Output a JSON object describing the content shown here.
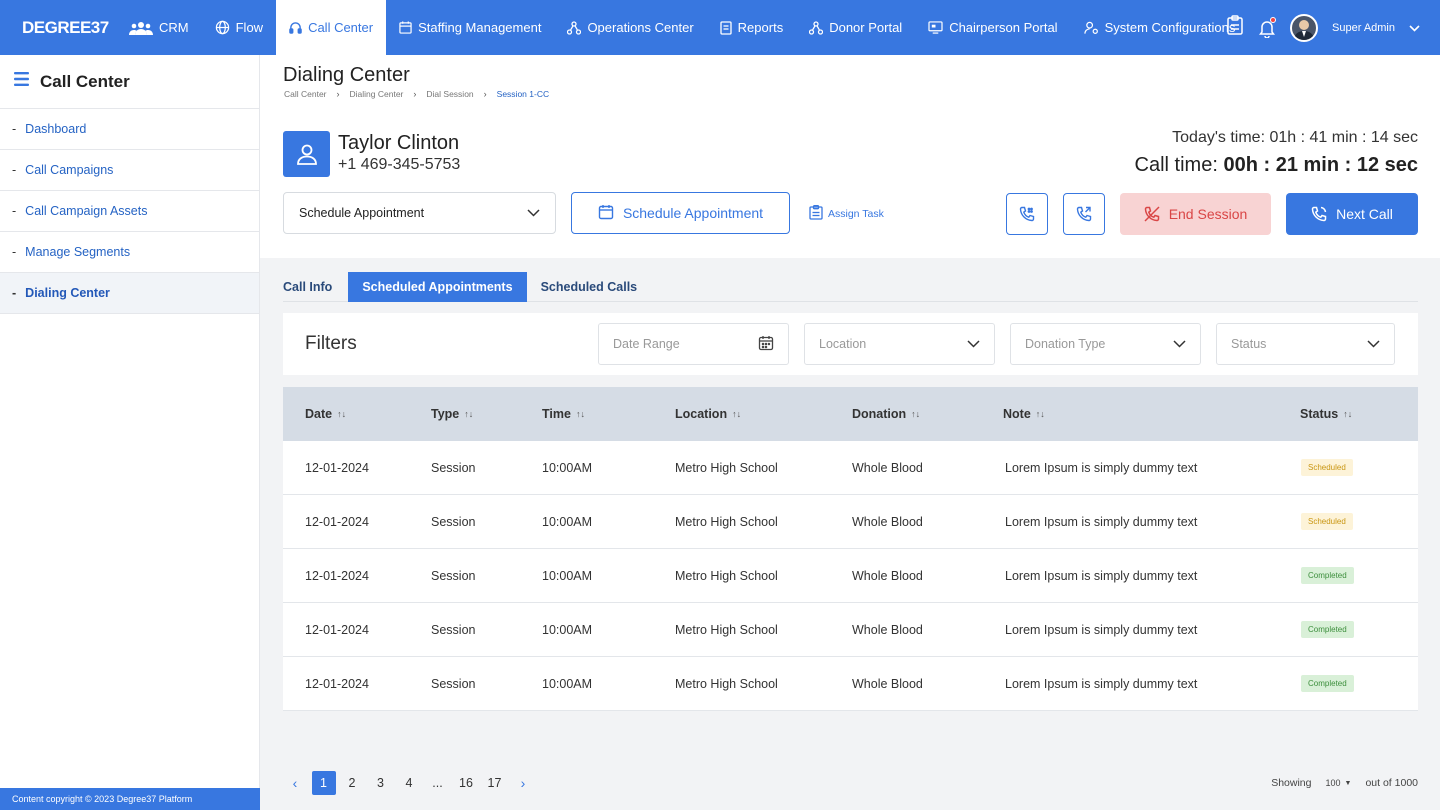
{
  "brand": "DEGREE37",
  "nav": {
    "items": [
      {
        "label": "CRM",
        "icon": "users-icon"
      },
      {
        "label": "Flow",
        "icon": "globe-icon"
      },
      {
        "label": "Call Center",
        "icon": "headset-icon",
        "active": true
      },
      {
        "label": "Staffing Management",
        "icon": "calendar-icon"
      },
      {
        "label": "Operations Center",
        "icon": "network-icon"
      },
      {
        "label": "Reports",
        "icon": "report-icon"
      },
      {
        "label": "Donor Portal",
        "icon": "network-icon"
      },
      {
        "label": "Chairperson Portal",
        "icon": "monitor-icon"
      },
      {
        "label": "System Configurations",
        "icon": "user-gear-icon"
      }
    ],
    "user_name": "Super Admin"
  },
  "sidebar": {
    "title": "Call Center",
    "items": [
      {
        "label": "Dashboard"
      },
      {
        "label": "Call Campaigns"
      },
      {
        "label": "Call Campaign Assets"
      },
      {
        "label": "Manage Segments"
      },
      {
        "label": "Dialing Center",
        "active": true
      }
    ],
    "footer": "Content copyright © 2023 Degree37 Platform"
  },
  "page": {
    "title": "Dialing Center",
    "breadcrumb": [
      "Call Center",
      "Dialing Center",
      "Dial Session",
      "Session 1-CC"
    ]
  },
  "contact": {
    "name": "Taylor Clinton",
    "phone": "+1 469-345-5753"
  },
  "timers": {
    "today_label": "Today's time:",
    "today_value": "01h : 41 min : 14 sec",
    "call_label": "Call time:",
    "call_value": "00h : 21 min : 12 sec"
  },
  "actions": {
    "select_value": "Schedule Appointment",
    "schedule_button": "Schedule Appointment",
    "assign_task": "Assign Task",
    "end_session": "End Session",
    "next_call": "Next Call"
  },
  "tabs": [
    {
      "label": "Call Info"
    },
    {
      "label": "Scheduled Appointments",
      "active": true
    },
    {
      "label": "Scheduled Calls"
    }
  ],
  "filters": {
    "label": "Filters",
    "date_range_placeholder": "Date Range",
    "location_placeholder": "Location",
    "donation_type_placeholder": "Donation Type",
    "status_placeholder": "Status"
  },
  "table": {
    "columns": [
      "Date",
      "Type",
      "Time",
      "Location",
      "Donation",
      "Note",
      "Status"
    ],
    "rows": [
      {
        "date": "12-01-2024",
        "type": "Session",
        "time": "10:00AM",
        "location": "Metro High School",
        "donation": "Whole Blood",
        "note": "Lorem Ipsum is simply dummy text",
        "status": "Scheduled"
      },
      {
        "date": "12-01-2024",
        "type": "Session",
        "time": "10:00AM",
        "location": "Metro High School",
        "donation": "Whole Blood",
        "note": "Lorem Ipsum is simply dummy text",
        "status": "Scheduled"
      },
      {
        "date": "12-01-2024",
        "type": "Session",
        "time": "10:00AM",
        "location": "Metro High School",
        "donation": "Whole Blood",
        "note": "Lorem Ipsum is simply dummy text",
        "status": "Completed"
      },
      {
        "date": "12-01-2024",
        "type": "Session",
        "time": "10:00AM",
        "location": "Metro High School",
        "donation": "Whole Blood",
        "note": "Lorem Ipsum is simply dummy text",
        "status": "Completed"
      },
      {
        "date": "12-01-2024",
        "type": "Session",
        "time": "10:00AM",
        "location": "Metro High School",
        "donation": "Whole Blood",
        "note": "Lorem Ipsum is simply dummy text",
        "status": "Completed"
      }
    ]
  },
  "pagination": {
    "pages": [
      "1",
      "2",
      "3",
      "4",
      "...",
      "16",
      "17"
    ],
    "current": "1",
    "showing_label": "Showing",
    "page_size": "100",
    "total_label": "out of 1000"
  },
  "colors": {
    "primary": "#3877e0",
    "danger_bg": "#f8d3d3",
    "danger_text": "#d94646",
    "scheduled": "#c99612",
    "completed": "#3d8f3d"
  }
}
